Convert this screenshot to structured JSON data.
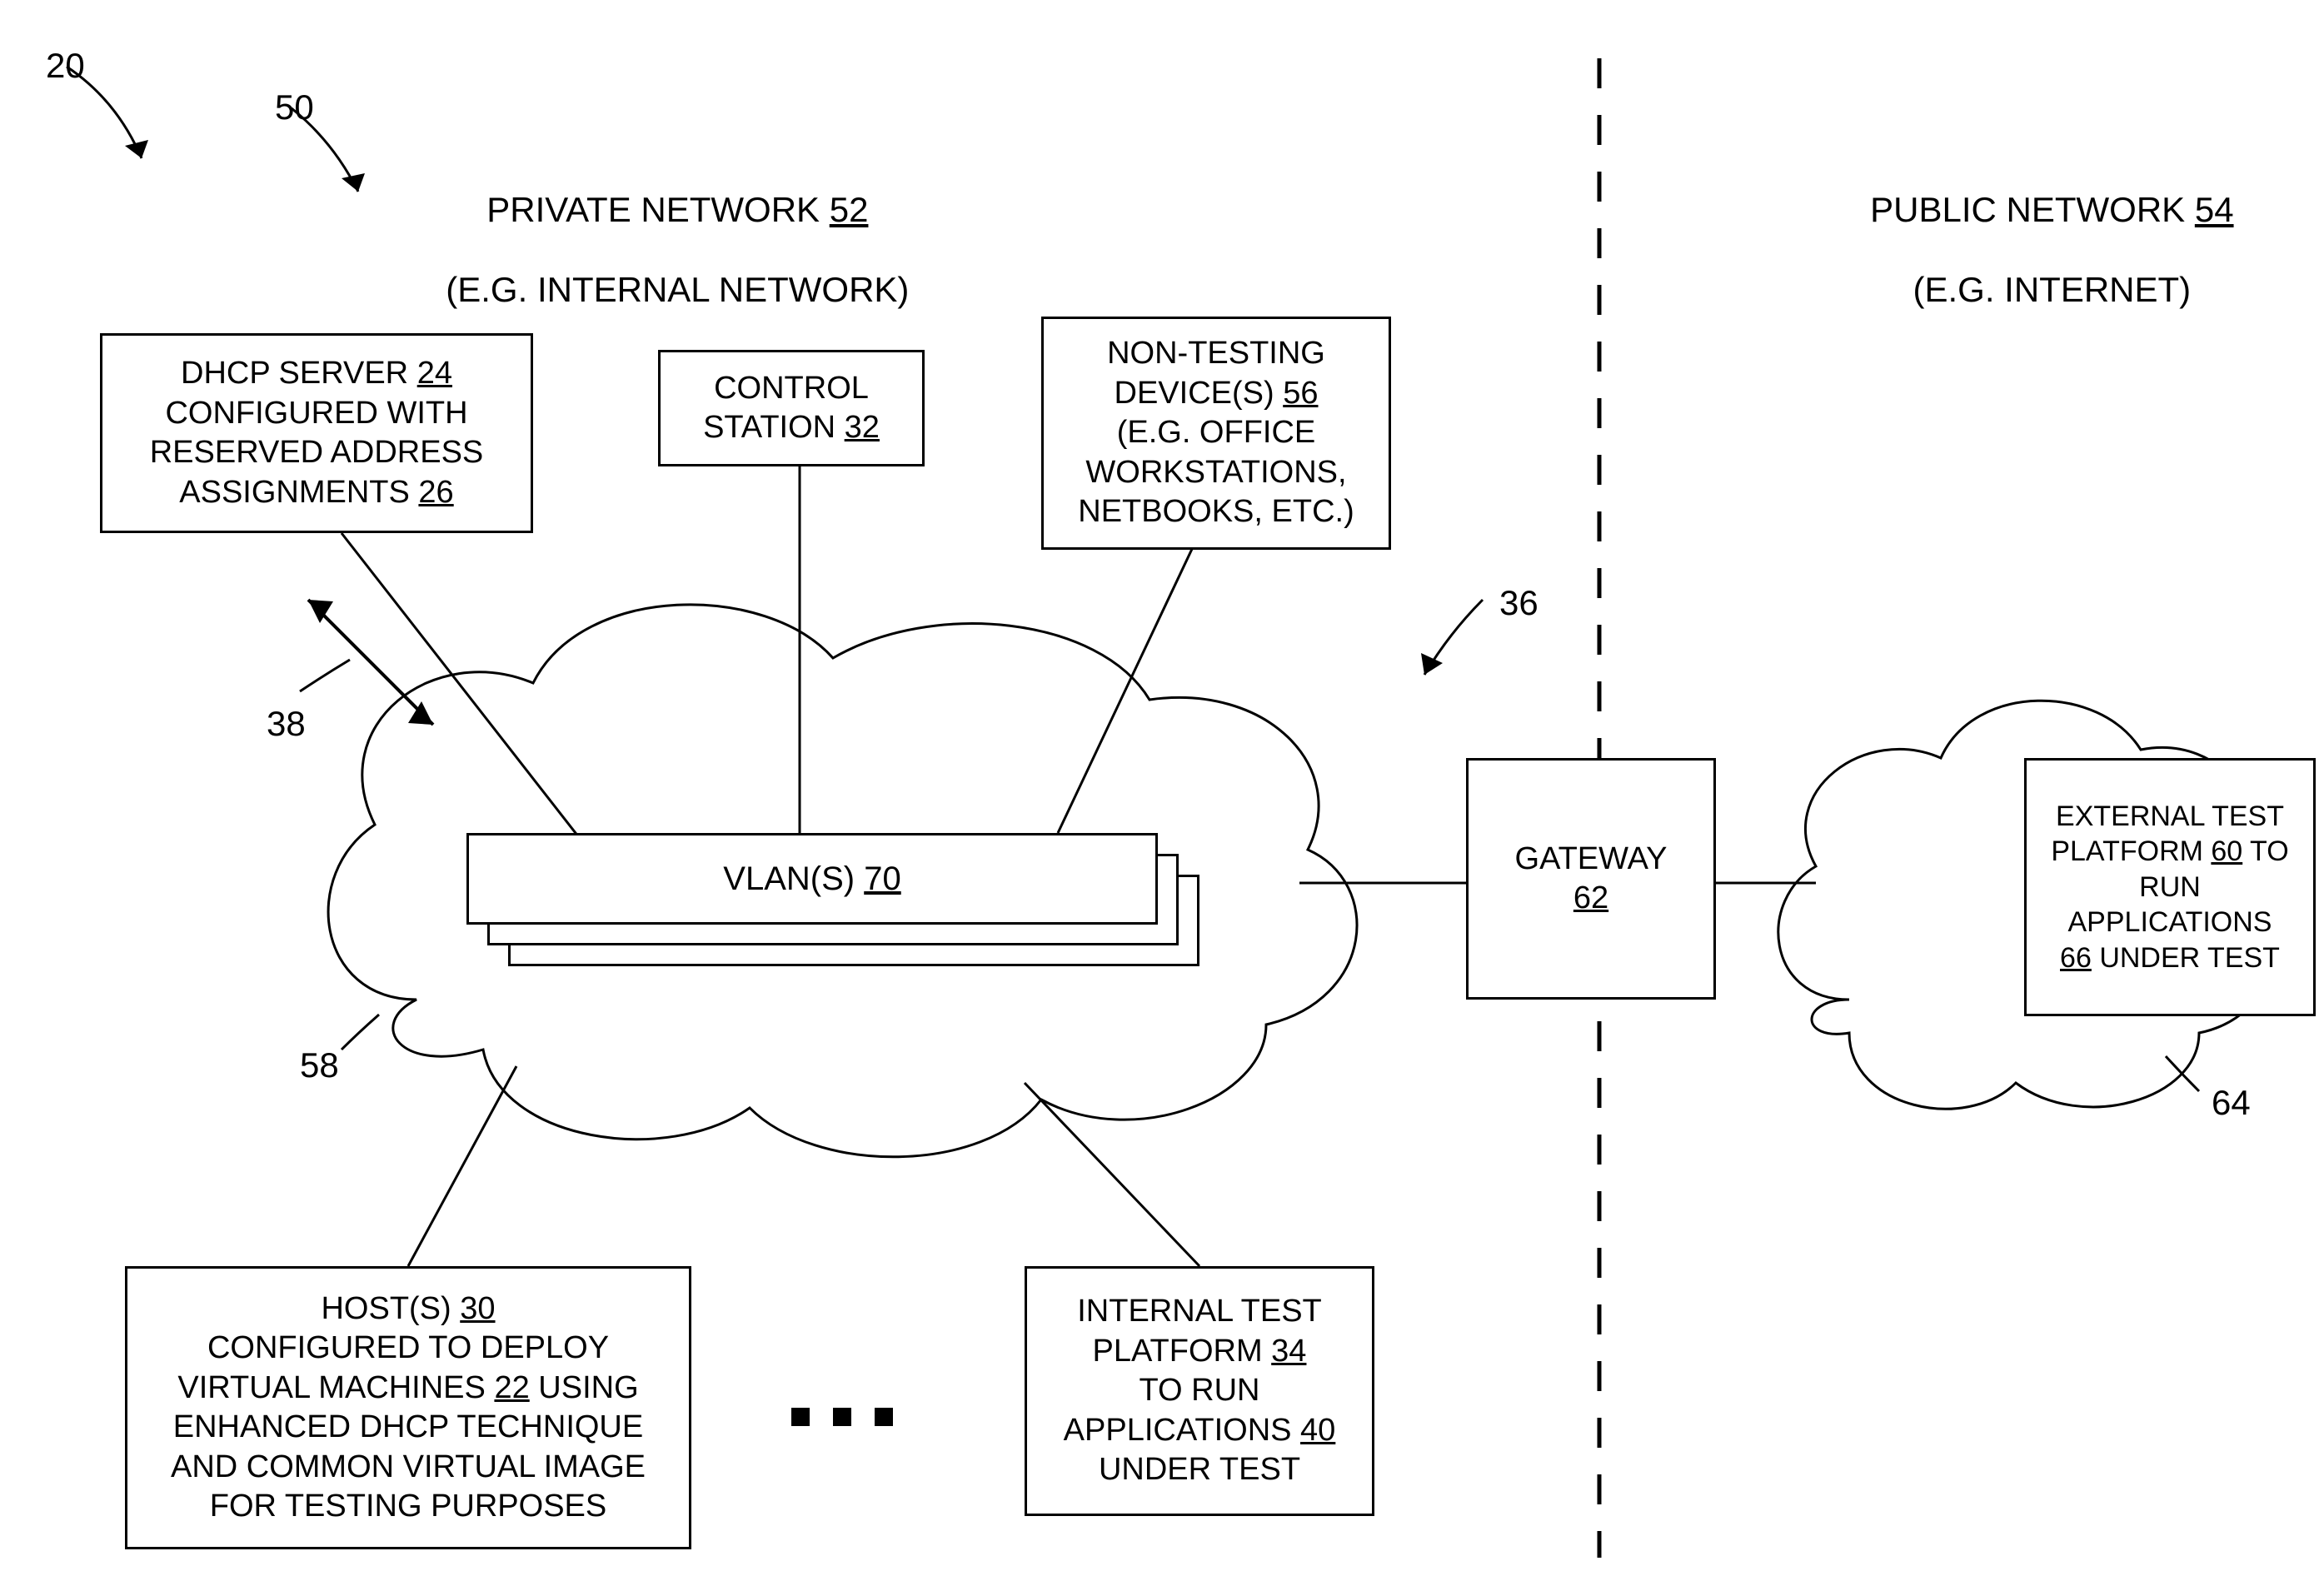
{
  "refs": {
    "r20": "20",
    "r50": "50",
    "r38": "38",
    "r36": "36",
    "r58": "58",
    "r64": "64"
  },
  "headers": {
    "private_line1": "PRIVATE NETWORK ",
    "private_ref": "52",
    "private_line2": "(E.G. INTERNAL NETWORK)",
    "public_line1": "PUBLIC NETWORK ",
    "public_ref": "54",
    "public_line2": "(E.G. INTERNET)"
  },
  "boxes": {
    "dhcp": {
      "l1": "DHCP SERVER ",
      "r1": "24",
      "l2": "CONFIGURED WITH",
      "l3": "RESERVED ADDRESS",
      "l4": "ASSIGNMENTS ",
      "r4": "26"
    },
    "control": {
      "l1": "CONTROL",
      "l2": "STATION ",
      "r2": "32"
    },
    "nontest": {
      "l1": "NON-TESTING",
      "l2": "DEVICE(S) ",
      "r2": "56",
      "l3": "(E.G. OFFICE",
      "l4": "WORKSTATIONS,",
      "l5": "NETBOOKS, ETC.)"
    },
    "vlan": {
      "l1": "VLAN(S) ",
      "r1": "70"
    },
    "gateway": {
      "l1": "GATEWAY",
      "r1": "62"
    },
    "external": {
      "l1": "EXTERNAL TEST",
      "l2": "PLATFORM ",
      "r2": "60",
      "l2b": " TO",
      "l3": "RUN",
      "l4": "APPLICATIONS",
      "r4": "66",
      "l4b": " UNDER TEST"
    },
    "hosts": {
      "l1": "HOST(S) ",
      "r1": "30",
      "l2": "CONFIGURED TO DEPLOY",
      "l3": "VIRTUAL MACHINES ",
      "r3": "22",
      "l3b": " USING",
      "l4": "ENHANCED DHCP TECHNIQUE",
      "l5": "AND COMMON VIRTUAL IMAGE",
      "l6": "FOR TESTING PURPOSES"
    },
    "internal": {
      "l1": "INTERNAL TEST",
      "l2": "PLATFORM ",
      "r2": "34",
      "l3": "TO RUN",
      "l4": "APPLICATIONS ",
      "r4": "40",
      "l5": "UNDER TEST"
    }
  }
}
